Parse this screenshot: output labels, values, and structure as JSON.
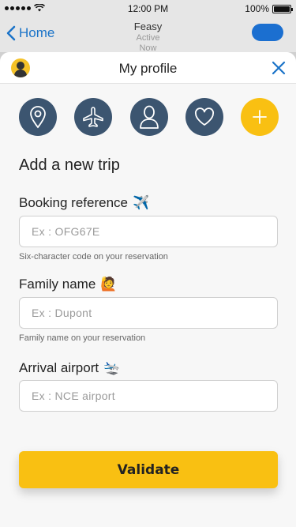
{
  "status_bar": {
    "time": "12:00 PM",
    "battery": "100%"
  },
  "nav": {
    "back_label": "Home",
    "title": "Feasy",
    "subtitle_line1": "Active",
    "subtitle_line2": "Now"
  },
  "sheet": {
    "title": "My profile"
  },
  "icons": [
    {
      "name": "location-pin-icon"
    },
    {
      "name": "airplane-icon"
    },
    {
      "name": "user-icon"
    },
    {
      "name": "heart-icon"
    },
    {
      "name": "plus-icon"
    }
  ],
  "form": {
    "section_title": "Add a new trip",
    "booking": {
      "label": "Booking reference",
      "emoji": "✈️",
      "placeholder": "Ex : OFG67E",
      "value": "",
      "hint": "Six-character code on your reservation"
    },
    "family": {
      "label": "Family name",
      "emoji": "🙋",
      "placeholder": "Ex : Dupont",
      "value": "",
      "hint": "Family name on your reservation"
    },
    "airport": {
      "label": "Arrival airport",
      "emoji": "🛬",
      "placeholder": "Ex : NCE airport",
      "value": ""
    },
    "validate_label": "Validate"
  },
  "colors": {
    "accent": "#f9c012",
    "icon_bg": "#3c5570",
    "link_blue": "#1a73c8"
  }
}
